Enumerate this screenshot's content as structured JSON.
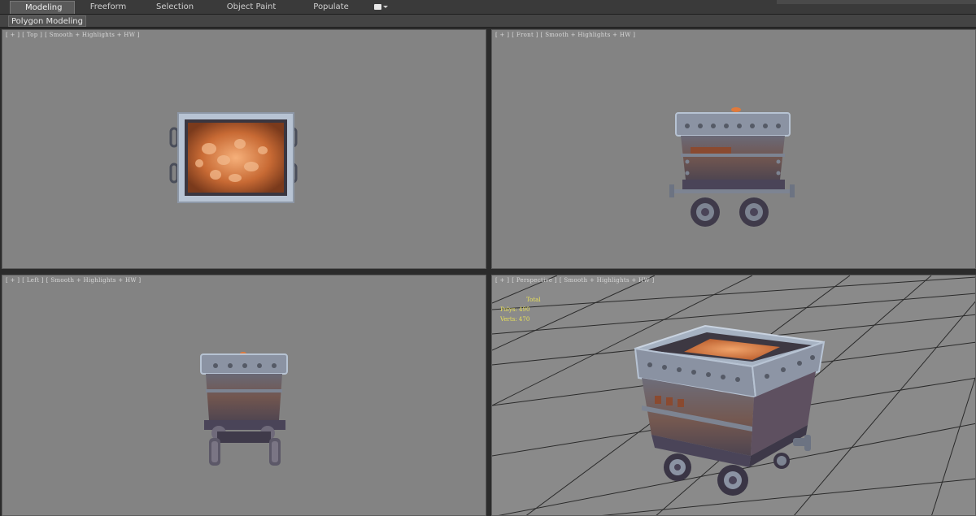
{
  "ribbon": {
    "tabs": [
      {
        "label": "Modeling",
        "active": true
      },
      {
        "label": "Freeform",
        "active": false
      },
      {
        "label": "Selection",
        "active": false
      },
      {
        "label": "Object Paint",
        "active": false
      },
      {
        "label": "Populate",
        "active": false
      }
    ],
    "panel_label": "Polygon Modeling"
  },
  "viewports": {
    "top": {
      "plus": "[ + ]",
      "name": "[ Top ]",
      "shading": "[ Smooth + Highlights + HW ]"
    },
    "front": {
      "plus": "[ + ]",
      "name": "[ Front ]",
      "shading": "[ Smooth + Highlights + HW ]"
    },
    "left": {
      "plus": "[ + ]",
      "name": "[ Left ]",
      "shading": "[ Smooth + Highlights + HW ]"
    },
    "perspective": {
      "plus": "[ + ]",
      "name": "[ Perspective ]",
      "shading": "[ Smooth + Highlights + HW ]",
      "stats": {
        "header": "Total",
        "polys_label": "Polys:",
        "polys_value": "490",
        "verts_label": "Verts:",
        "verts_value": "470"
      }
    }
  },
  "colors": {
    "viewport_bg": "#838383",
    "grid_line": "#2a2a2a",
    "stats_text": "#e8e05a",
    "cart_metal": "#7d8492",
    "cart_trim": "#b7c3d3",
    "cart_body": "#5a4c4c",
    "ore": "#d8733a"
  }
}
